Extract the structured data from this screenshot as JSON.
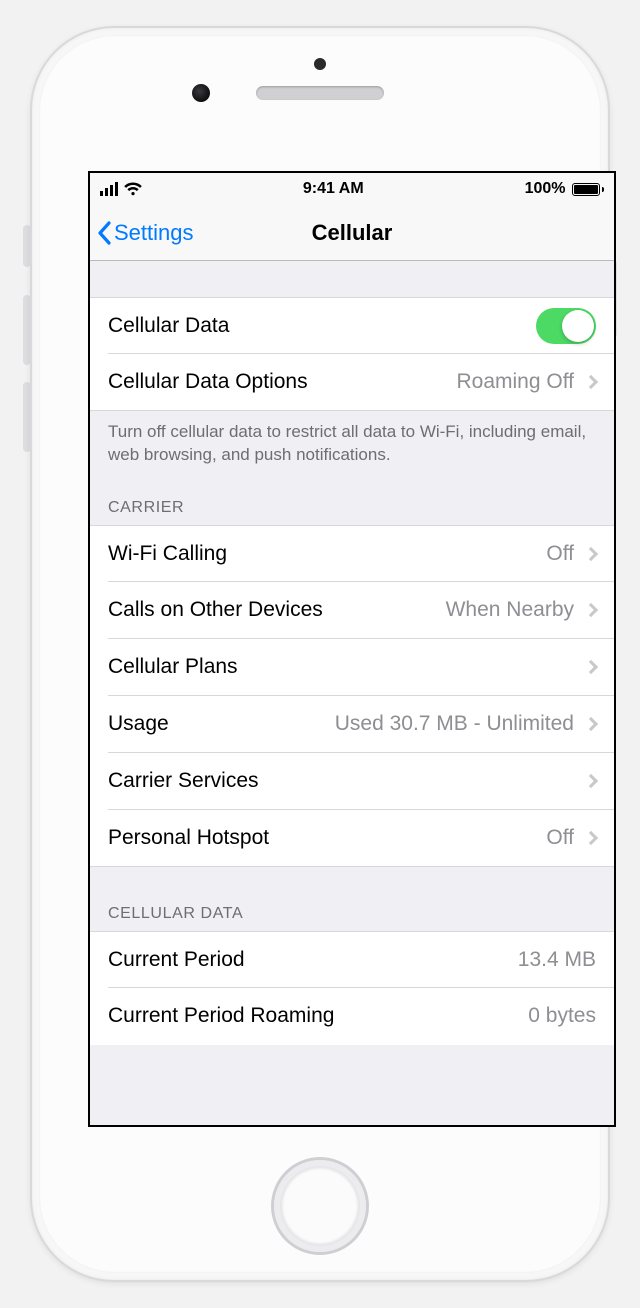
{
  "status": {
    "time": "9:41 AM",
    "battery": "100%"
  },
  "nav": {
    "back_label": "Settings",
    "title": "Cellular"
  },
  "section1": {
    "cellular_data_label": "Cellular Data",
    "options_label": "Cellular Data Options",
    "options_value": "Roaming Off",
    "footer": "Turn off cellular data to restrict all data to Wi-Fi, including email, web browsing, and push notifications."
  },
  "carrier": {
    "header": "CARRIER",
    "wifi_calling_label": "Wi-Fi Calling",
    "wifi_calling_value": "Off",
    "calls_other_label": "Calls on Other Devices",
    "calls_other_value": "When Nearby",
    "plans_label": "Cellular Plans",
    "usage_label": "Usage",
    "usage_value": "Used 30.7 MB - Unlimited",
    "carrier_services_label": "Carrier Services",
    "hotspot_label": "Personal Hotspot",
    "hotspot_value": "Off"
  },
  "data": {
    "header": "CELLULAR DATA",
    "current_period_label": "Current Period",
    "current_period_value": "13.4 MB",
    "current_roaming_label": "Current Period Roaming",
    "current_roaming_value": "0 bytes"
  }
}
